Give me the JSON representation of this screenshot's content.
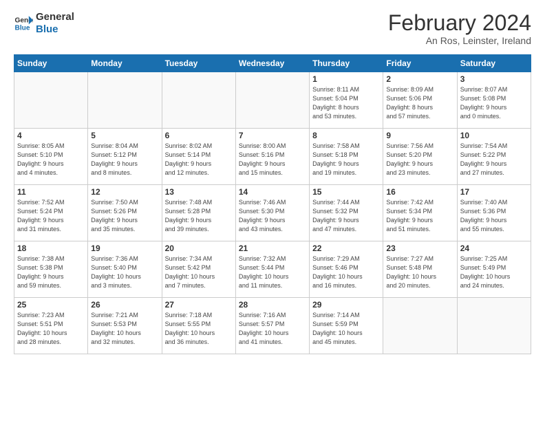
{
  "header": {
    "logo_line1": "General",
    "logo_line2": "Blue",
    "month": "February 2024",
    "location": "An Ros, Leinster, Ireland"
  },
  "weekdays": [
    "Sunday",
    "Monday",
    "Tuesday",
    "Wednesday",
    "Thursday",
    "Friday",
    "Saturday"
  ],
  "weeks": [
    [
      {
        "day": "",
        "info": ""
      },
      {
        "day": "",
        "info": ""
      },
      {
        "day": "",
        "info": ""
      },
      {
        "day": "",
        "info": ""
      },
      {
        "day": "1",
        "info": "Sunrise: 8:11 AM\nSunset: 5:04 PM\nDaylight: 8 hours\nand 53 minutes."
      },
      {
        "day": "2",
        "info": "Sunrise: 8:09 AM\nSunset: 5:06 PM\nDaylight: 8 hours\nand 57 minutes."
      },
      {
        "day": "3",
        "info": "Sunrise: 8:07 AM\nSunset: 5:08 PM\nDaylight: 9 hours\nand 0 minutes."
      }
    ],
    [
      {
        "day": "4",
        "info": "Sunrise: 8:05 AM\nSunset: 5:10 PM\nDaylight: 9 hours\nand 4 minutes."
      },
      {
        "day": "5",
        "info": "Sunrise: 8:04 AM\nSunset: 5:12 PM\nDaylight: 9 hours\nand 8 minutes."
      },
      {
        "day": "6",
        "info": "Sunrise: 8:02 AM\nSunset: 5:14 PM\nDaylight: 9 hours\nand 12 minutes."
      },
      {
        "day": "7",
        "info": "Sunrise: 8:00 AM\nSunset: 5:16 PM\nDaylight: 9 hours\nand 15 minutes."
      },
      {
        "day": "8",
        "info": "Sunrise: 7:58 AM\nSunset: 5:18 PM\nDaylight: 9 hours\nand 19 minutes."
      },
      {
        "day": "9",
        "info": "Sunrise: 7:56 AM\nSunset: 5:20 PM\nDaylight: 9 hours\nand 23 minutes."
      },
      {
        "day": "10",
        "info": "Sunrise: 7:54 AM\nSunset: 5:22 PM\nDaylight: 9 hours\nand 27 minutes."
      }
    ],
    [
      {
        "day": "11",
        "info": "Sunrise: 7:52 AM\nSunset: 5:24 PM\nDaylight: 9 hours\nand 31 minutes."
      },
      {
        "day": "12",
        "info": "Sunrise: 7:50 AM\nSunset: 5:26 PM\nDaylight: 9 hours\nand 35 minutes."
      },
      {
        "day": "13",
        "info": "Sunrise: 7:48 AM\nSunset: 5:28 PM\nDaylight: 9 hours\nand 39 minutes."
      },
      {
        "day": "14",
        "info": "Sunrise: 7:46 AM\nSunset: 5:30 PM\nDaylight: 9 hours\nand 43 minutes."
      },
      {
        "day": "15",
        "info": "Sunrise: 7:44 AM\nSunset: 5:32 PM\nDaylight: 9 hours\nand 47 minutes."
      },
      {
        "day": "16",
        "info": "Sunrise: 7:42 AM\nSunset: 5:34 PM\nDaylight: 9 hours\nand 51 minutes."
      },
      {
        "day": "17",
        "info": "Sunrise: 7:40 AM\nSunset: 5:36 PM\nDaylight: 9 hours\nand 55 minutes."
      }
    ],
    [
      {
        "day": "18",
        "info": "Sunrise: 7:38 AM\nSunset: 5:38 PM\nDaylight: 9 hours\nand 59 minutes."
      },
      {
        "day": "19",
        "info": "Sunrise: 7:36 AM\nSunset: 5:40 PM\nDaylight: 10 hours\nand 3 minutes."
      },
      {
        "day": "20",
        "info": "Sunrise: 7:34 AM\nSunset: 5:42 PM\nDaylight: 10 hours\nand 7 minutes."
      },
      {
        "day": "21",
        "info": "Sunrise: 7:32 AM\nSunset: 5:44 PM\nDaylight: 10 hours\nand 11 minutes."
      },
      {
        "day": "22",
        "info": "Sunrise: 7:29 AM\nSunset: 5:46 PM\nDaylight: 10 hours\nand 16 minutes."
      },
      {
        "day": "23",
        "info": "Sunrise: 7:27 AM\nSunset: 5:48 PM\nDaylight: 10 hours\nand 20 minutes."
      },
      {
        "day": "24",
        "info": "Sunrise: 7:25 AM\nSunset: 5:49 PM\nDaylight: 10 hours\nand 24 minutes."
      }
    ],
    [
      {
        "day": "25",
        "info": "Sunrise: 7:23 AM\nSunset: 5:51 PM\nDaylight: 10 hours\nand 28 minutes."
      },
      {
        "day": "26",
        "info": "Sunrise: 7:21 AM\nSunset: 5:53 PM\nDaylight: 10 hours\nand 32 minutes."
      },
      {
        "day": "27",
        "info": "Sunrise: 7:18 AM\nSunset: 5:55 PM\nDaylight: 10 hours\nand 36 minutes."
      },
      {
        "day": "28",
        "info": "Sunrise: 7:16 AM\nSunset: 5:57 PM\nDaylight: 10 hours\nand 41 minutes."
      },
      {
        "day": "29",
        "info": "Sunrise: 7:14 AM\nSunset: 5:59 PM\nDaylight: 10 hours\nand 45 minutes."
      },
      {
        "day": "",
        "info": ""
      },
      {
        "day": "",
        "info": ""
      }
    ]
  ]
}
